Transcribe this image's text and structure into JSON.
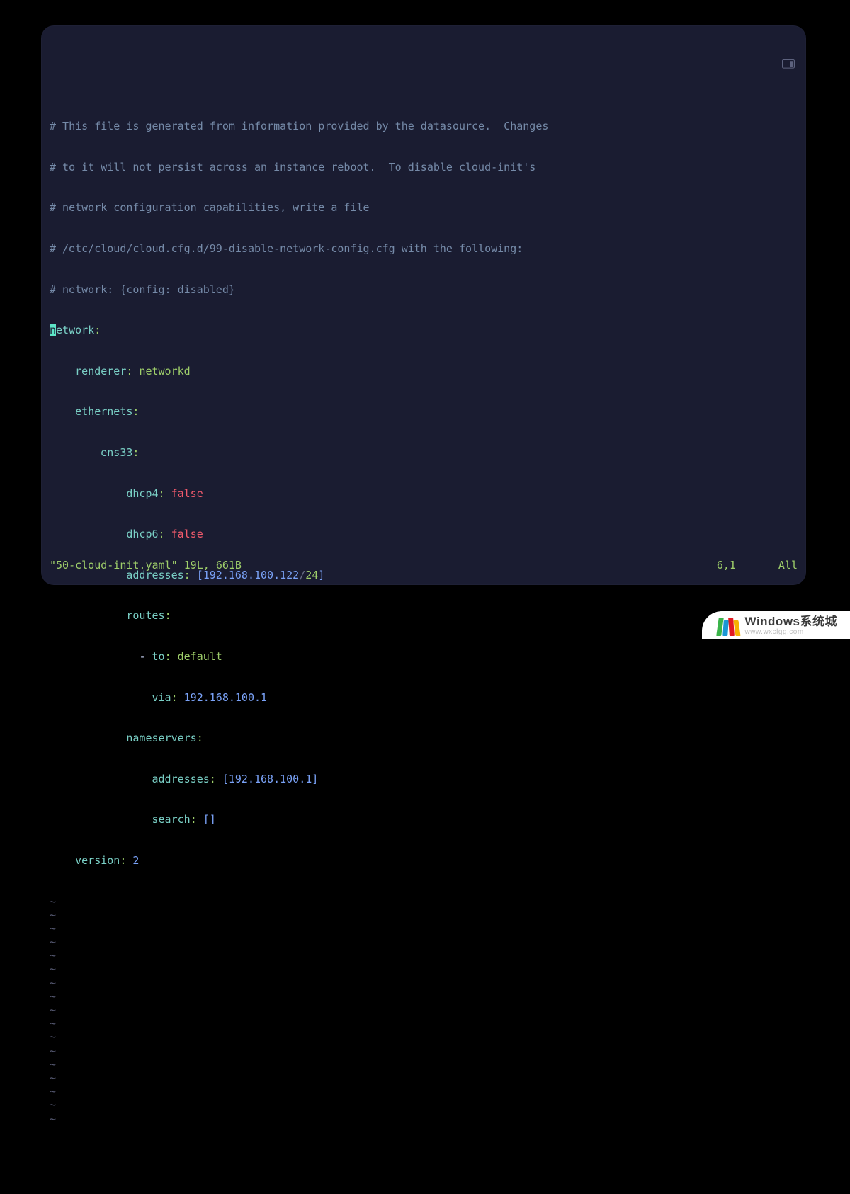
{
  "editor": {
    "filename": "50-cloud-init.yaml",
    "lines_stat": "19L",
    "bytes_stat": "661B",
    "cursor_pos": "6,1",
    "scroll_state": "All",
    "cursor_line_index": 5,
    "cursor_col_index": 0,
    "empty_line_rows": 17,
    "comment_lines": [
      "# This file is generated from information provided by the datasource.  Changes",
      "# to it will not persist across an instance reboot.  To disable cloud-init's",
      "# network configuration capabilities, write a file",
      "# /etc/cloud/cloud.cfg.d/99-disable-network-config.cfg with the following:",
      "# network: {config: disabled}"
    ],
    "yaml": {
      "top_key": "network",
      "renderer_key": "renderer",
      "renderer_val": "networkd",
      "ethernets_key": "ethernets",
      "iface": "ens33",
      "dhcp4_key": "dhcp4",
      "dhcp4_val": "false",
      "dhcp6_key": "dhcp6",
      "dhcp6_val": "false",
      "addresses_key": "addresses",
      "address_ip": "192.168.100.122",
      "address_cidr": "24",
      "routes_key": "routes",
      "route_to_key": "to",
      "route_to_val": "default",
      "route_via_key": "via",
      "route_via_val": "192.168.100.1",
      "nameservers_key": "nameservers",
      "ns_addresses_key": "addresses",
      "ns_address_val": "192.168.100.1",
      "search_key": "search",
      "version_key": "version",
      "version_val": "2"
    }
  },
  "watermark": {
    "title": "Windows系统城",
    "url": "www.wxclgg.com"
  }
}
